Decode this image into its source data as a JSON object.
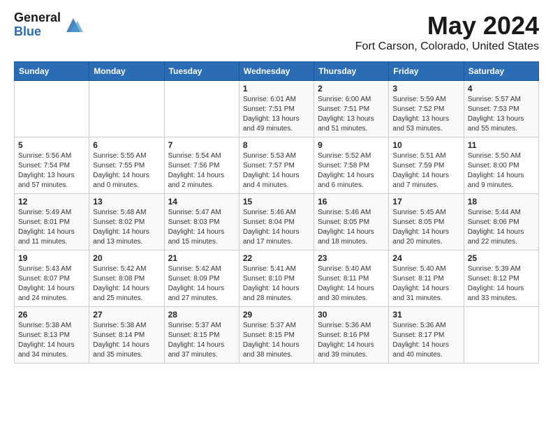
{
  "header": {
    "logo_general": "General",
    "logo_blue": "Blue",
    "title": "May 2024",
    "location": "Fort Carson, Colorado, United States"
  },
  "days_of_week": [
    "Sunday",
    "Monday",
    "Tuesday",
    "Wednesday",
    "Thursday",
    "Friday",
    "Saturday"
  ],
  "weeks": [
    [
      {
        "day": "",
        "info": ""
      },
      {
        "day": "",
        "info": ""
      },
      {
        "day": "",
        "info": ""
      },
      {
        "day": "1",
        "info": "Sunrise: 6:01 AM\nSunset: 7:51 PM\nDaylight: 13 hours\nand 49 minutes."
      },
      {
        "day": "2",
        "info": "Sunrise: 6:00 AM\nSunset: 7:51 PM\nDaylight: 13 hours\nand 51 minutes."
      },
      {
        "day": "3",
        "info": "Sunrise: 5:59 AM\nSunset: 7:52 PM\nDaylight: 13 hours\nand 53 minutes."
      },
      {
        "day": "4",
        "info": "Sunrise: 5:57 AM\nSunset: 7:53 PM\nDaylight: 13 hours\nand 55 minutes."
      }
    ],
    [
      {
        "day": "5",
        "info": "Sunrise: 5:56 AM\nSunset: 7:54 PM\nDaylight: 13 hours\nand 57 minutes."
      },
      {
        "day": "6",
        "info": "Sunrise: 5:55 AM\nSunset: 7:55 PM\nDaylight: 14 hours\nand 0 minutes."
      },
      {
        "day": "7",
        "info": "Sunrise: 5:54 AM\nSunset: 7:56 PM\nDaylight: 14 hours\nand 2 minutes."
      },
      {
        "day": "8",
        "info": "Sunrise: 5:53 AM\nSunset: 7:57 PM\nDaylight: 14 hours\nand 4 minutes."
      },
      {
        "day": "9",
        "info": "Sunrise: 5:52 AM\nSunset: 7:58 PM\nDaylight: 14 hours\nand 6 minutes."
      },
      {
        "day": "10",
        "info": "Sunrise: 5:51 AM\nSunset: 7:59 PM\nDaylight: 14 hours\nand 7 minutes."
      },
      {
        "day": "11",
        "info": "Sunrise: 5:50 AM\nSunset: 8:00 PM\nDaylight: 14 hours\nand 9 minutes."
      }
    ],
    [
      {
        "day": "12",
        "info": "Sunrise: 5:49 AM\nSunset: 8:01 PM\nDaylight: 14 hours\nand 11 minutes."
      },
      {
        "day": "13",
        "info": "Sunrise: 5:48 AM\nSunset: 8:02 PM\nDaylight: 14 hours\nand 13 minutes."
      },
      {
        "day": "14",
        "info": "Sunrise: 5:47 AM\nSunset: 8:03 PM\nDaylight: 14 hours\nand 15 minutes."
      },
      {
        "day": "15",
        "info": "Sunrise: 5:46 AM\nSunset: 8:04 PM\nDaylight: 14 hours\nand 17 minutes."
      },
      {
        "day": "16",
        "info": "Sunrise: 5:46 AM\nSunset: 8:05 PM\nDaylight: 14 hours\nand 18 minutes."
      },
      {
        "day": "17",
        "info": "Sunrise: 5:45 AM\nSunset: 8:05 PM\nDaylight: 14 hours\nand 20 minutes."
      },
      {
        "day": "18",
        "info": "Sunrise: 5:44 AM\nSunset: 8:06 PM\nDaylight: 14 hours\nand 22 minutes."
      }
    ],
    [
      {
        "day": "19",
        "info": "Sunrise: 5:43 AM\nSunset: 8:07 PM\nDaylight: 14 hours\nand 24 minutes."
      },
      {
        "day": "20",
        "info": "Sunrise: 5:42 AM\nSunset: 8:08 PM\nDaylight: 14 hours\nand 25 minutes."
      },
      {
        "day": "21",
        "info": "Sunrise: 5:42 AM\nSunset: 8:09 PM\nDaylight: 14 hours\nand 27 minutes."
      },
      {
        "day": "22",
        "info": "Sunrise: 5:41 AM\nSunset: 8:10 PM\nDaylight: 14 hours\nand 28 minutes."
      },
      {
        "day": "23",
        "info": "Sunrise: 5:40 AM\nSunset: 8:11 PM\nDaylight: 14 hours\nand 30 minutes."
      },
      {
        "day": "24",
        "info": "Sunrise: 5:40 AM\nSunset: 8:11 PM\nDaylight: 14 hours\nand 31 minutes."
      },
      {
        "day": "25",
        "info": "Sunrise: 5:39 AM\nSunset: 8:12 PM\nDaylight: 14 hours\nand 33 minutes."
      }
    ],
    [
      {
        "day": "26",
        "info": "Sunrise: 5:38 AM\nSunset: 8:13 PM\nDaylight: 14 hours\nand 34 minutes."
      },
      {
        "day": "27",
        "info": "Sunrise: 5:38 AM\nSunset: 8:14 PM\nDaylight: 14 hours\nand 35 minutes."
      },
      {
        "day": "28",
        "info": "Sunrise: 5:37 AM\nSunset: 8:15 PM\nDaylight: 14 hours\nand 37 minutes."
      },
      {
        "day": "29",
        "info": "Sunrise: 5:37 AM\nSunset: 8:15 PM\nDaylight: 14 hours\nand 38 minutes."
      },
      {
        "day": "30",
        "info": "Sunrise: 5:36 AM\nSunset: 8:16 PM\nDaylight: 14 hours\nand 39 minutes."
      },
      {
        "day": "31",
        "info": "Sunrise: 5:36 AM\nSunset: 8:17 PM\nDaylight: 14 hours\nand 40 minutes."
      },
      {
        "day": "",
        "info": ""
      }
    ]
  ]
}
